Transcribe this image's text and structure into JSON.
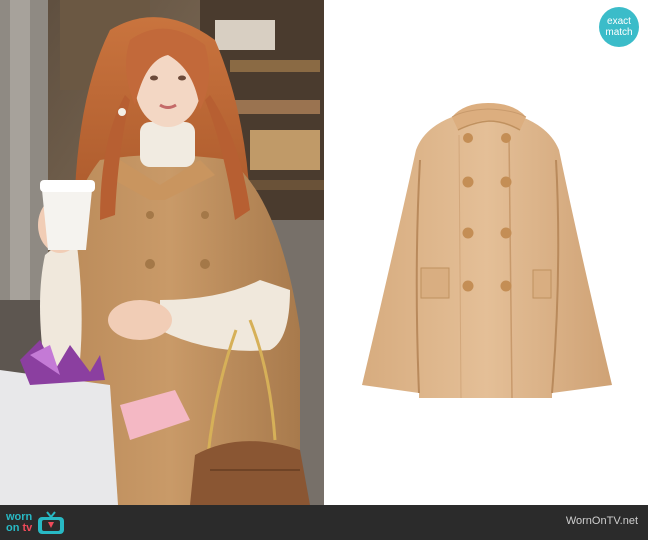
{
  "badge": {
    "line1": "exact",
    "line2": "match"
  },
  "footer": {
    "logo_worn": "worn",
    "logo_on": "on",
    "logo_tv": "tv",
    "site_url": "WornOnTV.net"
  },
  "colors": {
    "accent_teal": "#3bbcc9",
    "accent_red": "#f04a5a",
    "footer_bg": "#2b2b2b",
    "coat_camel": "#dcb38a"
  },
  "icons": [
    "tv-icon"
  ]
}
